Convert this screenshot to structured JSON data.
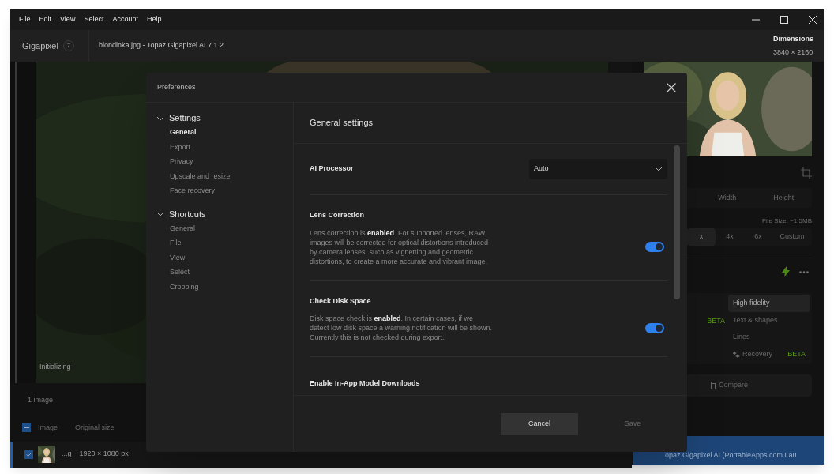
{
  "menu": [
    "File",
    "Edit",
    "View",
    "Select",
    "Account",
    "Help"
  ],
  "header": {
    "app_name": "Gigapixel",
    "badge": "7",
    "title": "blondinka.jpg - Topaz Gigapixel AI 7.1.2",
    "dimensions_label": "Dimensions",
    "dimensions_value": "3840 × 2160"
  },
  "canvas": {
    "status": "Initializing"
  },
  "queue": {
    "count": "1 image",
    "select_all": {
      "indeterminate": true
    },
    "columns": [
      "Image",
      "Original size"
    ],
    "rows": [
      {
        "name": "...g",
        "size": "1920 × 1080 px",
        "checked": true,
        "selected": true
      }
    ]
  },
  "right_panel": {
    "size_modes": [
      {
        "label": "Width",
        "selected": false
      },
      {
        "label": "Height",
        "selected": false
      }
    ],
    "file_size": "File Size: ~1,5MB",
    "scales": [
      {
        "label": "x",
        "selected": true
      },
      {
        "label": "4x",
        "selected": false
      },
      {
        "label": "6x",
        "selected": false
      },
      {
        "label": "Custom",
        "selected": false
      }
    ],
    "side_badge": "BETA",
    "models": [
      {
        "label": "High fidelity",
        "selected": true
      },
      {
        "label": "Text & shapes",
        "selected": false
      },
      {
        "label": "Lines",
        "selected": false
      },
      {
        "label": "Recovery",
        "selected": false,
        "badge": "BETA"
      }
    ],
    "compare": "Compare",
    "export_bar": "opaz Gigapixel AI (PortableApps.com Lau"
  },
  "dialog": {
    "title": "Preferences",
    "nav": [
      {
        "label": "Settings",
        "expanded": true,
        "children": [
          {
            "label": "General",
            "selected": true
          },
          {
            "label": "Export",
            "selected": false
          },
          {
            "label": "Privacy",
            "selected": false
          },
          {
            "label": "Upscale and resize",
            "selected": false
          },
          {
            "label": "Face recovery",
            "selected": false
          }
        ]
      },
      {
        "label": "Shortcuts",
        "expanded": true,
        "children": [
          {
            "label": "General",
            "selected": false
          },
          {
            "label": "File",
            "selected": false
          },
          {
            "label": "View",
            "selected": false
          },
          {
            "label": "Select",
            "selected": false
          },
          {
            "label": "Cropping",
            "selected": false
          }
        ]
      }
    ],
    "section_title": "General settings",
    "settings": [
      {
        "kind": "select",
        "label": "AI Processor",
        "value": "Auto"
      },
      {
        "kind": "toggle",
        "label": "Lens Correction",
        "description": "Lens correction is **enabled**. For supported lenses, RAW images will be corrected for optical distortions introduced by camera lenses, such as vignetting and geometric distortions, to create a more accurate and vibrant image.",
        "on": true
      },
      {
        "kind": "toggle",
        "label": "Check Disk Space",
        "description": "Disk space check is **enabled**. In certain cases, if we detect low disk space a warning notification will be shown. Currently this is not checked during export.",
        "on": true
      },
      {
        "kind": "label",
        "label": "Enable In-App Model Downloads"
      }
    ],
    "buttons": [
      {
        "label": "Cancel",
        "disabled": false
      },
      {
        "label": "Save",
        "disabled": true
      }
    ]
  }
}
